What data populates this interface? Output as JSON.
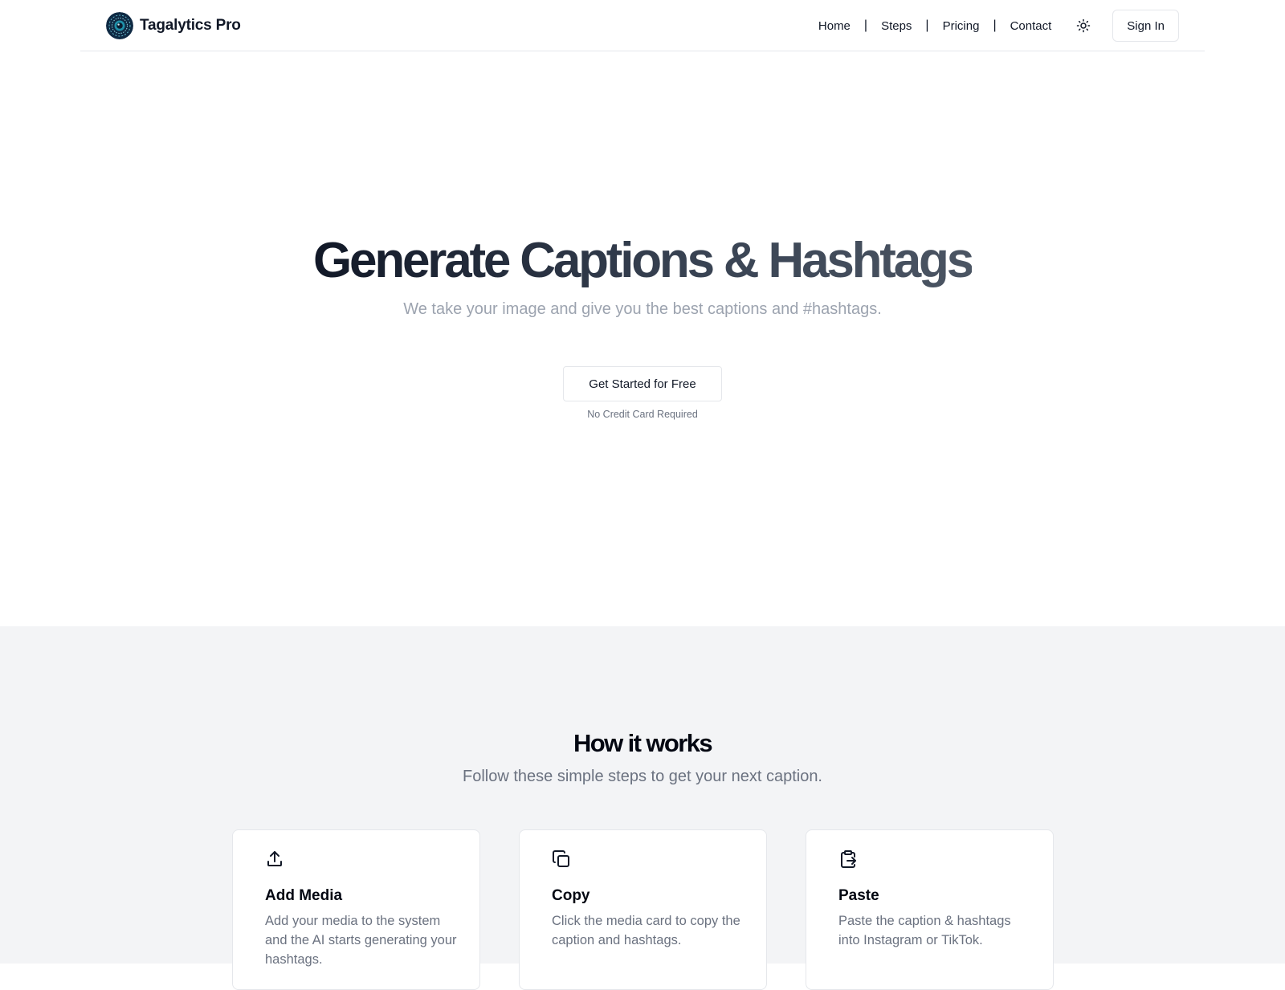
{
  "header": {
    "brand_name": "Tagalytics Pro",
    "logo_icon": "circuit-eye-logo",
    "nav": [
      {
        "label": "Home"
      },
      {
        "label": "Steps"
      },
      {
        "label": "Pricing"
      },
      {
        "label": "Contact"
      }
    ],
    "separator": "|",
    "theme_toggle_icon": "sun-icon",
    "sign_in_label": "Sign In"
  },
  "hero": {
    "title": "Generate Captions & Hashtags",
    "subtitle": "We take your image and give you the best captions and #hashtags.",
    "cta_label": "Get Started for Free",
    "cta_note": "No Credit Card Required"
  },
  "how_it_works": {
    "title": "How it works",
    "subtitle": "Follow these simple steps to get your next caption.",
    "steps": [
      {
        "icon": "upload-icon",
        "title": "Add Media",
        "description": "Add your media to the system and the AI starts generating your hashtags."
      },
      {
        "icon": "copy-icon",
        "title": "Copy",
        "description": "Click the media card to copy the caption and hashtags."
      },
      {
        "icon": "clipboard-paste-icon",
        "title": "Paste",
        "description": "Paste the caption & hashtags into Instagram or TikTok."
      }
    ]
  },
  "colors": {
    "background": "#ffffff",
    "section_background": "#f3f4f6",
    "text_primary": "#111827",
    "text_muted": "#6b7280",
    "border": "#e5e7eb"
  }
}
